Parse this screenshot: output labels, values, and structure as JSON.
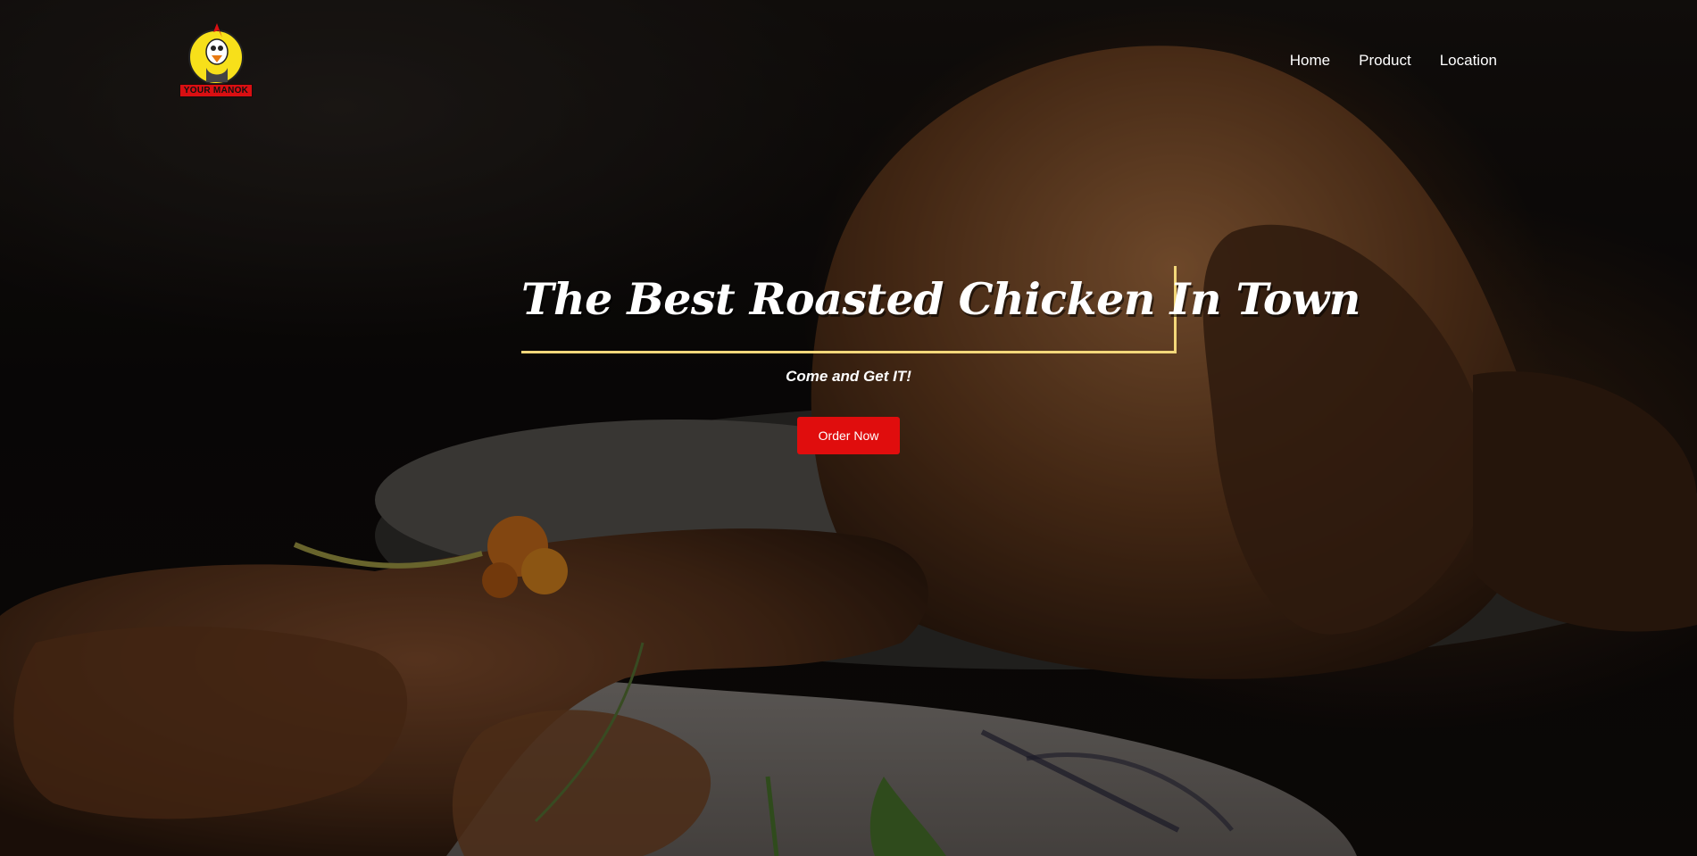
{
  "brand": {
    "logo_text": "YOUR MANOK"
  },
  "nav": {
    "items": [
      {
        "label": "Home"
      },
      {
        "label": "Product"
      },
      {
        "label": "Location"
      }
    ]
  },
  "hero": {
    "title": "The Best Roasted Chicken In Town",
    "subtitle": "Come and Get IT!",
    "cta_label": "Order Now"
  },
  "colors": {
    "accent_red": "#e00d0d",
    "title_border": "#f3d77a",
    "logo_yellow": "#f7e01a"
  }
}
